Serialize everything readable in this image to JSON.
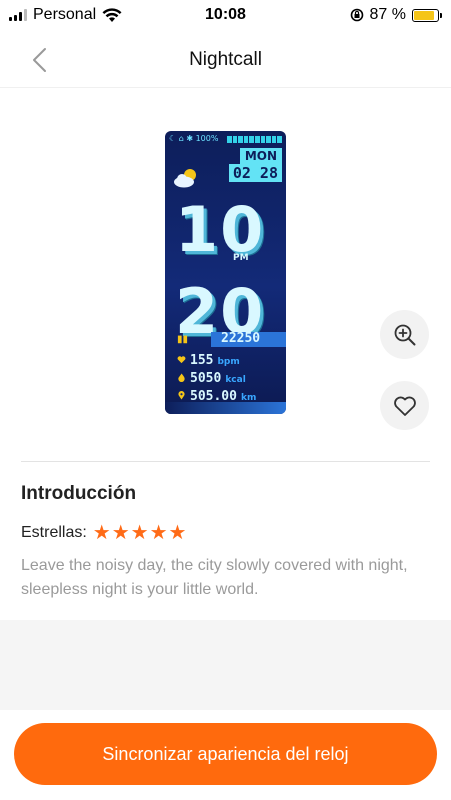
{
  "status_bar": {
    "carrier": "Personal",
    "time": "10:08",
    "battery_percent": "87 %",
    "battery_level": 0.87
  },
  "nav": {
    "title": "Nightcall",
    "back_icon": "chevron-left-icon"
  },
  "watch_face": {
    "status_text": "☾ ⌂ ✱ 100%",
    "day": "MON",
    "date": "02 28",
    "hour": "10",
    "ampm": "PM",
    "minute": "20",
    "steps": "22250",
    "heart_rate": "155",
    "heart_unit": "bpm",
    "calories": "5050",
    "calories_unit": "kcal",
    "distance": "505.00",
    "distance_unit": "km",
    "accent_color": "#63e3f5",
    "background_color": "#132a78"
  },
  "actions": {
    "zoom_icon": "zoom-in-icon",
    "favorite_icon": "heart-outline-icon"
  },
  "intro": {
    "title": "Introducción",
    "stars_label": "Estrellas:",
    "stars": 5,
    "description": "Leave the noisy day, the city slowly covered with night, sleepless night is your little world."
  },
  "sync_button": {
    "label": "Sincronizar apariencia del reloj",
    "color": "#ff6a0d"
  }
}
